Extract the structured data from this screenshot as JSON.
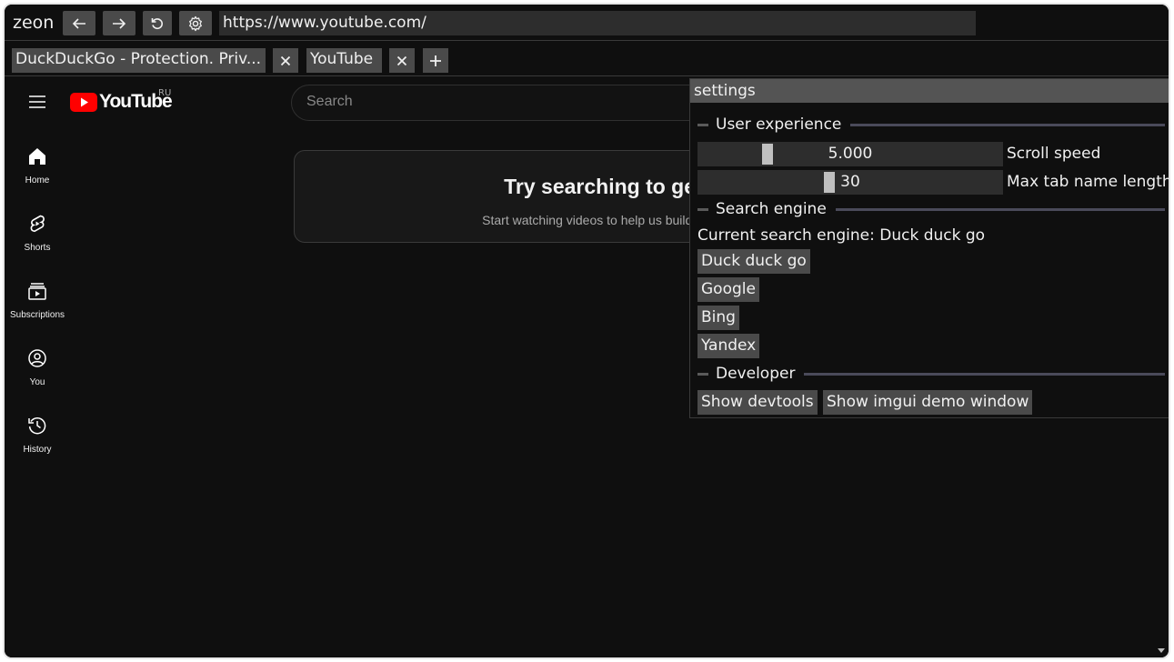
{
  "app": {
    "title": "zeon"
  },
  "toolbar": {
    "back_icon": "arrow-left-icon",
    "forward_icon": "arrow-right-icon",
    "reload_icon": "reload-icon",
    "settings_icon": "gear-icon",
    "url": "https://www.youtube.com/"
  },
  "tabs": [
    {
      "label": "DuckDuckGo - Protection. Priv..."
    },
    {
      "label": "YouTube"
    }
  ],
  "youtube": {
    "logo_text": "YouTube",
    "region": "RU",
    "search_placeholder": "Search",
    "sidebar": [
      {
        "label": "Home",
        "icon": "home-icon"
      },
      {
        "label": "Shorts",
        "icon": "shorts-icon"
      },
      {
        "label": "Subscriptions",
        "icon": "subscriptions-icon"
      },
      {
        "label": "You",
        "icon": "user-icon"
      },
      {
        "label": "History",
        "icon": "history-icon"
      }
    ],
    "card": {
      "title": "Try searching to get s",
      "subtitle": "Start watching videos to help us build a feed o"
    }
  },
  "settings": {
    "title": "settings",
    "user_experience": {
      "heading": "User experience",
      "scroll_speed": {
        "value": "5.000",
        "label": "Scroll speed",
        "level": 0.22
      },
      "max_tab_name_length": {
        "value": "30",
        "label": "Max tab name length",
        "level": 0.43
      }
    },
    "search_engine": {
      "heading": "Search engine",
      "current": "Current search engine: Duck duck go",
      "options": [
        "Duck duck go",
        "Google",
        "Bing",
        "Yandex"
      ]
    },
    "developer": {
      "heading": "Developer",
      "show_devtools": "Show devtools",
      "show_imgui_demo": "Show imgui demo window"
    }
  },
  "colors": {
    "background": "#0f0f0f",
    "button": "#4a4a4a",
    "youtube_red": "#ff0000",
    "panel_title": "#545454"
  }
}
